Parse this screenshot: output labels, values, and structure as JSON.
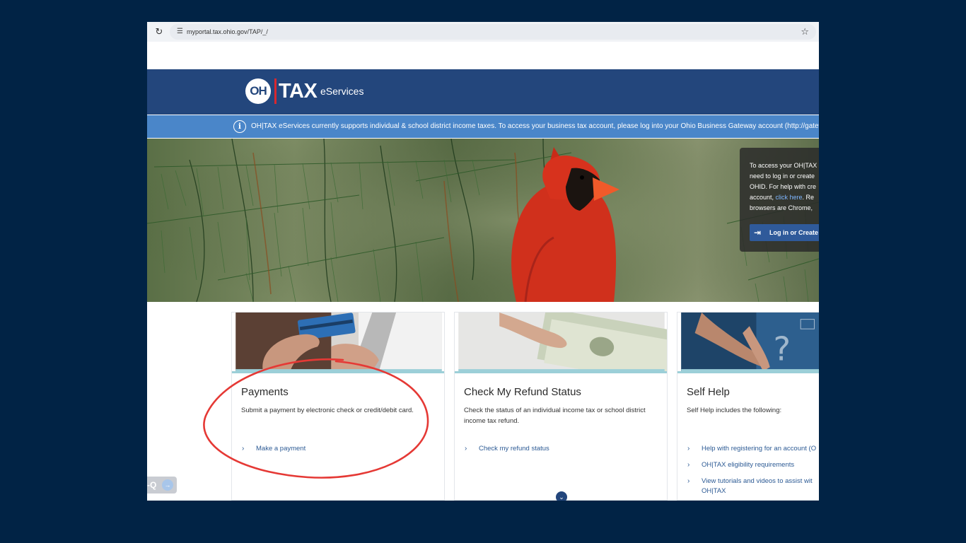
{
  "browser": {
    "url": "myportal.tax.ohio.gov/TAP/_/",
    "reload_icon": "reload-icon",
    "star_icon": "star-icon"
  },
  "header": {
    "logo_oh": "OH",
    "logo_tax": "TAX",
    "logo_suffix": "eServices"
  },
  "notice": {
    "text": "OH|TAX eServices currently supports individual & school district income taxes. To access your business tax account, please log into your Ohio Business Gateway account (http://gatewa"
  },
  "login_panel": {
    "line1": "To access your OH|TAX",
    "line2": "need to log in or create",
    "line3": "OHID. For help with cre",
    "line4_pre": "account, ",
    "line4_link": "click here",
    "line4_post": ". Re",
    "line5": "browsers are Chrome,",
    "button_label": "Log in or Create"
  },
  "cards": [
    {
      "title": "Payments",
      "description": "Submit a payment by electronic check or credit/debit card.",
      "links": [
        "Make a payment"
      ]
    },
    {
      "title": "Check My Refund Status",
      "description": "Check the status of an individual income tax or school district income tax refund.",
      "links": [
        "Check my refund status"
      ]
    },
    {
      "title": "Self Help",
      "description": "Self Help includes the following:",
      "links": [
        "Help with registering for an account (O",
        "OH|TAX eligibility requirements",
        "View tutorials and videos to assist wit"
      ],
      "link3_line2": "OH|TAX"
    }
  ],
  "chat_tab": {
    "label": "-Q"
  },
  "colors": {
    "page_bg": "#012345",
    "header_bg": "#23467c",
    "notice_bg": "#4a86c9",
    "link": "#2c5a94",
    "annotation": "#e53935"
  }
}
